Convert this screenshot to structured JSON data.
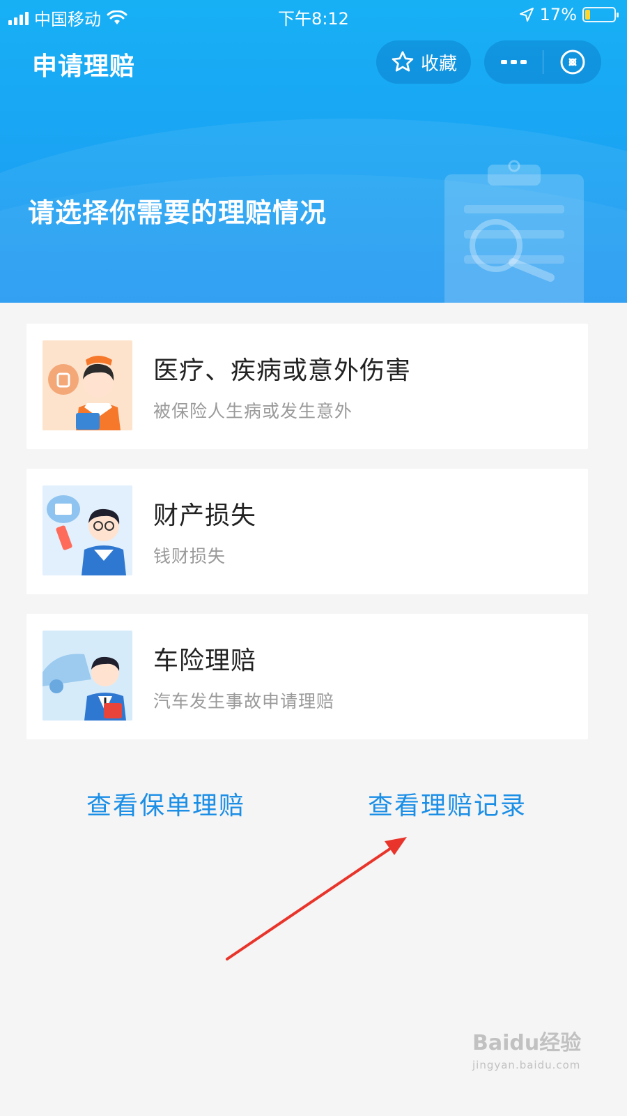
{
  "status_bar": {
    "carrier": "中国移动",
    "time": "下午8:12",
    "battery_percent": "17%",
    "battery_level": 0.17
  },
  "nav": {
    "title": "申请理赔",
    "favorite_label": "收藏"
  },
  "banner": {
    "heading": "请选择你需要的理赔情况"
  },
  "options": [
    {
      "title": "医疗、疾病或意外伤害",
      "subtitle": "被保险人生病或发生意外"
    },
    {
      "title": "财产损失",
      "subtitle": "钱财损失"
    },
    {
      "title": "车险理赔",
      "subtitle": "汽车发生事故申请理赔"
    }
  ],
  "links": {
    "policy_claims": "查看保单理赔",
    "claim_records": "查看理赔记录"
  },
  "watermark": {
    "brand": "Baidu经验",
    "url": "jingyan.baidu.com"
  },
  "colors": {
    "header_blue": "#17b0f5",
    "link_blue": "#1b8ee6",
    "annotation_red": "#e8342a"
  },
  "icons": {
    "favorite": "star-icon",
    "more": "more-icon",
    "close": "close-icon",
    "location": "location-arrow-icon",
    "wifi": "wifi-icon"
  }
}
